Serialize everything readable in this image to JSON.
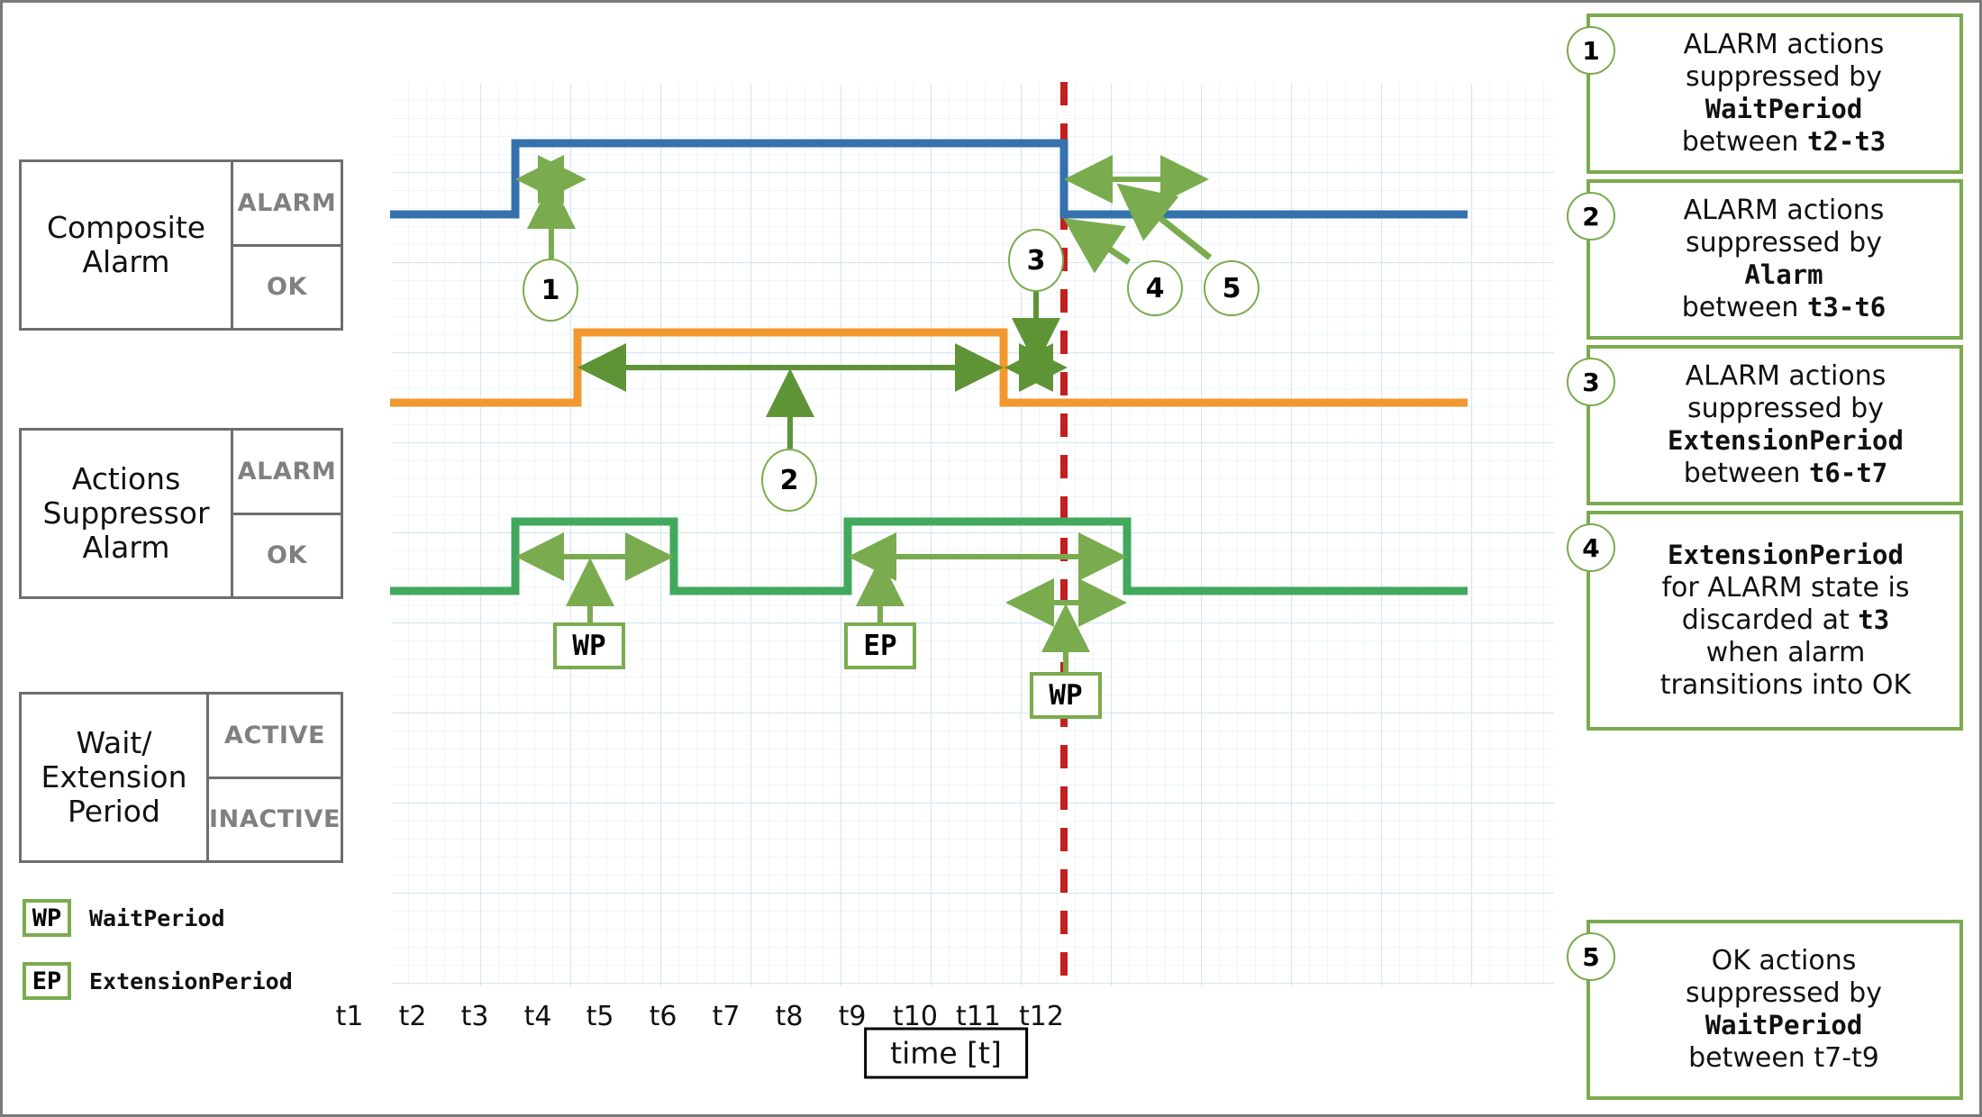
{
  "legend": {
    "items": [
      {
        "chip": "WP",
        "label": "WaitPeriod"
      },
      {
        "chip": "EP",
        "label": "ExtensionPeriod"
      }
    ]
  },
  "state_rows": [
    {
      "name": "Composite\nAlarm",
      "name_line1": "Composite",
      "name_line2": "Alarm",
      "high": "ALARM",
      "low": "OK"
    },
    {
      "name": "Actions Suppressor Alarm",
      "name_line1": "Actions",
      "name_line2": "Suppressor",
      "name_line3": "Alarm",
      "high": "ALARM",
      "low": "OK"
    },
    {
      "name": "Wait/ Extension Period",
      "name_line1": "Wait/",
      "name_line2": "Extension",
      "name_line3": "Period",
      "high": "ACTIVE",
      "low": "INACTIVE"
    }
  ],
  "axis": {
    "ticks": [
      "t1",
      "t2",
      "t3",
      "t4",
      "t5",
      "t6",
      "t7",
      "t8",
      "t9",
      "t10",
      "t11",
      "t12"
    ],
    "caption": "time [t]"
  },
  "plot_tags": [
    {
      "id": "wp-1",
      "label": "WP"
    },
    {
      "id": "ep-1",
      "label": "EP"
    },
    {
      "id": "wp-2",
      "label": "WP"
    }
  ],
  "plot_bubbles": [
    "1",
    "2",
    "3",
    "4",
    "5"
  ],
  "notes": [
    {
      "num": "1",
      "line1": "ALARM actions",
      "line2": "suppressed by",
      "mono": "WaitPeriod",
      "line3_pre": "between ",
      "line3_mono": "t2-t3"
    },
    {
      "num": "2",
      "line1": "ALARM actions",
      "line2": "suppressed by",
      "mono": "Alarm",
      "line3_pre": "between ",
      "line3_mono": "t3-t6"
    },
    {
      "num": "3",
      "line1": "ALARM actions",
      "line2": "suppressed by",
      "mono": "ExtensionPeriod",
      "line3_pre": "between ",
      "line3_mono": "t6-t7"
    },
    {
      "num": "4",
      "mono": "ExtensionPeriod",
      "line1": "for ALARM state is",
      "line2_pre": "discarded at ",
      "line2_mono": "t3",
      "line3": "when alarm",
      "line4": "transitions into OK"
    },
    {
      "num": "5",
      "line1": "OK actions",
      "line2": "suppressed by",
      "mono": "WaitPeriod",
      "line3_plain": "between t7-t9"
    }
  ],
  "colors": {
    "composite_alarm": "#3572AD",
    "suppressor_alarm": "#F2982F",
    "wait_extension": "#42A85C",
    "marker_line": "#C3201F",
    "annotation_green": "#7aab4e",
    "grid_minor": "#e4f0f7",
    "grid_major": "#cfe4f0"
  },
  "chart_data": {
    "type": "line",
    "title": "",
    "xlabel": "time [t]",
    "x": [
      "t1",
      "t2",
      "t3",
      "t4",
      "t5",
      "t6",
      "t7",
      "t8",
      "t9",
      "t10",
      "t11",
      "t12"
    ],
    "grid": true,
    "marker_time": "t7",
    "series": [
      {
        "name": "Composite Alarm",
        "color": "#3572AD",
        "states": [
          "OK",
          "ALARM"
        ],
        "steps": [
          {
            "from": "t0",
            "to": "t2",
            "value": "OK"
          },
          {
            "from": "t2",
            "to": "t7",
            "value": "ALARM"
          },
          {
            "from": "t7",
            "to": "t12",
            "value": "OK"
          }
        ]
      },
      {
        "name": "Actions Suppressor Alarm",
        "color": "#F2982F",
        "states": [
          "OK",
          "ALARM"
        ],
        "steps": [
          {
            "from": "t0",
            "to": "t3",
            "value": "OK"
          },
          {
            "from": "t3",
            "to": "t6",
            "value": "ALARM"
          },
          {
            "from": "t6",
            "to": "t12",
            "value": "OK"
          }
        ]
      },
      {
        "name": "Wait/Extension Period",
        "color": "#42A85C",
        "states": [
          "INACTIVE",
          "ACTIVE"
        ],
        "steps": [
          {
            "from": "t0",
            "to": "t2",
            "value": "INACTIVE"
          },
          {
            "from": "t2",
            "to": "t4",
            "value": "ACTIVE"
          },
          {
            "from": "t4",
            "to": "t6",
            "value": "INACTIVE"
          },
          {
            "from": "t6",
            "to": "t9",
            "value": "ACTIVE"
          },
          {
            "from": "t9",
            "to": "t12",
            "value": "INACTIVE"
          }
        ]
      }
    ],
    "intervals": [
      {
        "label": "1",
        "from": "t2",
        "to": "t3",
        "on": "Composite Alarm"
      },
      {
        "label": "2",
        "from": "t3",
        "to": "t6",
        "on": "Actions Suppressor Alarm"
      },
      {
        "label": "3",
        "from": "t6",
        "to": "t7",
        "on": "Actions Suppressor Alarm"
      },
      {
        "label": "WP",
        "from": "t2",
        "to": "t4",
        "on": "Wait/Extension Period"
      },
      {
        "label": "EP",
        "from": "t6",
        "to": "t9",
        "on": "Wait/Extension Period"
      },
      {
        "label": "WP",
        "from": "t7",
        "to": "t9",
        "on": "Wait/Extension Period"
      },
      {
        "label": "5",
        "from": "t7",
        "to": "t9",
        "on": "Composite Alarm"
      }
    ]
  }
}
